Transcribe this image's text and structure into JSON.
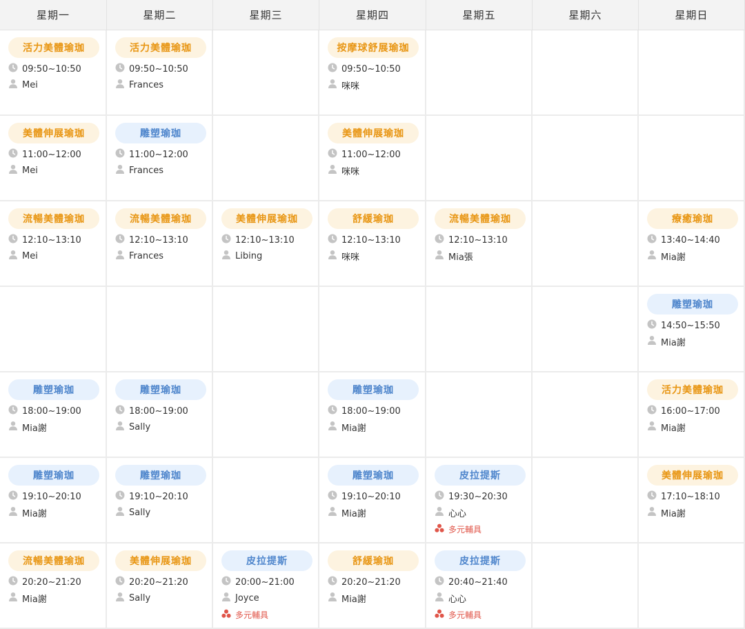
{
  "days": [
    "星期一",
    "星期二",
    "星期三",
    "星期四",
    "星期五",
    "星期六",
    "星期日"
  ],
  "colors": {
    "orange_text": "#e89614",
    "orange_bg": "#fdf3e0",
    "blue_text": "#4f86cc",
    "blue_bg": "#e7f1fd",
    "equipment": "#e0564a"
  },
  "icons": {
    "time": "clock-icon",
    "teacher": "person-icon",
    "equipment": "equipment-icon"
  },
  "classes": [
    {
      "day": 0,
      "slot": 0,
      "name": "活力美體瑜珈",
      "color": "orange",
      "time": "09:50~10:50",
      "teacher": "Mei"
    },
    {
      "day": 1,
      "slot": 0,
      "name": "活力美體瑜珈",
      "color": "orange",
      "time": "09:50~10:50",
      "teacher": "Frances"
    },
    {
      "day": 3,
      "slot": 0,
      "name": "按摩球舒展瑜珈",
      "color": "orange",
      "time": "09:50~10:50",
      "teacher": "咪咪"
    },
    {
      "day": 0,
      "slot": 1,
      "name": "美體伸展瑜珈",
      "color": "orange",
      "time": "11:00~12:00",
      "teacher": "Mei"
    },
    {
      "day": 1,
      "slot": 1,
      "name": "雕塑瑜珈",
      "color": "blue",
      "time": "11:00~12:00",
      "teacher": "Frances"
    },
    {
      "day": 3,
      "slot": 1,
      "name": "美體伸展瑜珈",
      "color": "orange",
      "time": "11:00~12:00",
      "teacher": "咪咪"
    },
    {
      "day": 0,
      "slot": 2,
      "name": "流暢美體瑜珈",
      "color": "orange",
      "time": "12:10~13:10",
      "teacher": "Mei"
    },
    {
      "day": 1,
      "slot": 2,
      "name": "流暢美體瑜珈",
      "color": "orange",
      "time": "12:10~13:10",
      "teacher": "Frances"
    },
    {
      "day": 2,
      "slot": 2,
      "name": "美體伸展瑜珈",
      "color": "orange",
      "time": "12:10~13:10",
      "teacher": "Libing"
    },
    {
      "day": 3,
      "slot": 2,
      "name": "舒緩瑜珈",
      "color": "orange",
      "time": "12:10~13:10",
      "teacher": "咪咪"
    },
    {
      "day": 4,
      "slot": 2,
      "name": "流暢美體瑜珈",
      "color": "orange",
      "time": "12:10~13:10",
      "teacher": "Mia張"
    },
    {
      "day": 6,
      "slot": 2,
      "name": "療癒瑜珈",
      "color": "orange",
      "time": "13:40~14:40",
      "teacher": "Mia謝"
    },
    {
      "day": 6,
      "slot": 3,
      "name": "雕塑瑜珈",
      "color": "blue",
      "time": "14:50~15:50",
      "teacher": "Mia謝"
    },
    {
      "day": 0,
      "slot": 4,
      "name": "雕塑瑜珈",
      "color": "blue",
      "time": "18:00~19:00",
      "teacher": "Mia謝"
    },
    {
      "day": 1,
      "slot": 4,
      "name": "雕塑瑜珈",
      "color": "blue",
      "time": "18:00~19:00",
      "teacher": "Sally"
    },
    {
      "day": 3,
      "slot": 4,
      "name": "雕塑瑜珈",
      "color": "blue",
      "time": "18:00~19:00",
      "teacher": "Mia謝"
    },
    {
      "day": 6,
      "slot": 4,
      "name": "活力美體瑜珈",
      "color": "orange",
      "time": "16:00~17:00",
      "teacher": "Mia謝"
    },
    {
      "day": 0,
      "slot": 5,
      "name": "雕塑瑜珈",
      "color": "blue",
      "time": "19:10~20:10",
      "teacher": "Mia謝"
    },
    {
      "day": 1,
      "slot": 5,
      "name": "雕塑瑜珈",
      "color": "blue",
      "time": "19:10~20:10",
      "teacher": "Sally"
    },
    {
      "day": 3,
      "slot": 5,
      "name": "雕塑瑜珈",
      "color": "blue",
      "time": "19:10~20:10",
      "teacher": "Mia謝"
    },
    {
      "day": 4,
      "slot": 5,
      "name": "皮拉提斯",
      "color": "blue",
      "time": "19:30~20:30",
      "teacher": "心心",
      "equipment": "多元輔具"
    },
    {
      "day": 6,
      "slot": 5,
      "name": "美體伸展瑜珈",
      "color": "orange",
      "time": "17:10~18:10",
      "teacher": "Mia謝"
    },
    {
      "day": 0,
      "slot": 6,
      "name": "流暢美體瑜珈",
      "color": "orange",
      "time": "20:20~21:20",
      "teacher": "Mia謝"
    },
    {
      "day": 1,
      "slot": 6,
      "name": "美體伸展瑜珈",
      "color": "orange",
      "time": "20:20~21:20",
      "teacher": "Sally"
    },
    {
      "day": 2,
      "slot": 6,
      "name": "皮拉提斯",
      "color": "blue",
      "time": "20:00~21:00",
      "teacher": "Joyce",
      "equipment": "多元輔具"
    },
    {
      "day": 3,
      "slot": 6,
      "name": "舒緩瑜珈",
      "color": "orange",
      "time": "20:20~21:20",
      "teacher": "Mia謝"
    },
    {
      "day": 4,
      "slot": 6,
      "name": "皮拉提斯",
      "color": "blue",
      "time": "20:40~21:40",
      "teacher": "心心",
      "equipment": "多元輔具"
    }
  ]
}
